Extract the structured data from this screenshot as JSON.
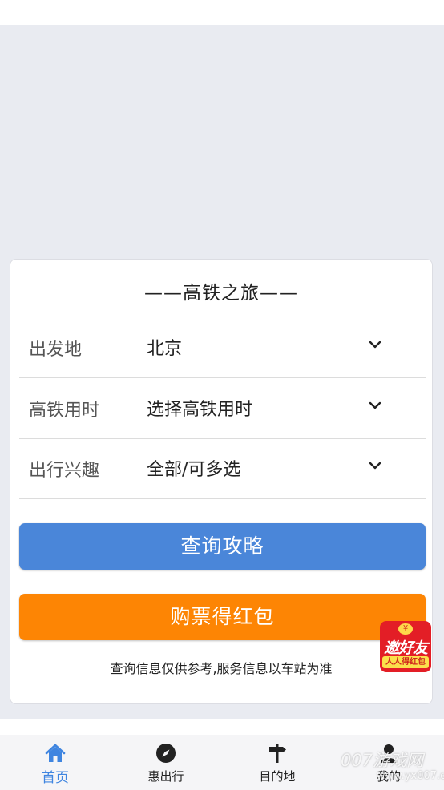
{
  "card": {
    "title": "——高铁之旅——",
    "rows": [
      {
        "label": "出发地",
        "value": "北京"
      },
      {
        "label": "高铁用时",
        "value": "选择高铁用时"
      },
      {
        "label": "出行兴趣",
        "value": "全部/可多选"
      }
    ],
    "query_button": "查询攻略",
    "buy_button": "购票得红包",
    "notice": "查询信息仅供参考,服务信息以车站为准"
  },
  "promo": {
    "coin": "¥",
    "main": "邀好友",
    "sub": "人人得红包"
  },
  "tabs": [
    {
      "label": "首页",
      "icon": "home-icon",
      "active": true
    },
    {
      "label": "惠出行",
      "icon": "compass-icon",
      "active": false
    },
    {
      "label": "目的地",
      "icon": "signpost-icon",
      "active": false
    },
    {
      "label": "我的",
      "icon": "person-icon",
      "active": false
    }
  ],
  "watermark": {
    "text": "007游戏网",
    "url": "www.yx007.com"
  },
  "colors": {
    "primary": "#4a86d9",
    "accent": "#fd8504",
    "tab_active": "#3f85e0",
    "background": "#e9ebf1"
  }
}
